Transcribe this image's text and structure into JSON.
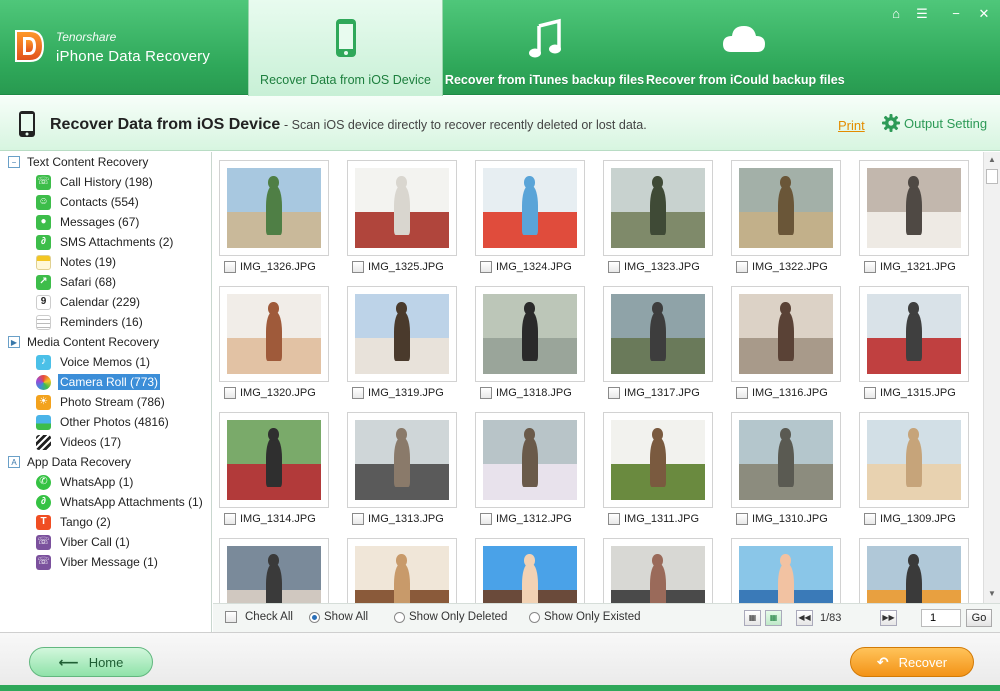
{
  "brand": {
    "company": "Tenorshare",
    "product": "iPhone Data Recovery"
  },
  "tabs": [
    {
      "label": "Recover Data from iOS Device",
      "icon": "phone-icon",
      "active": true
    },
    {
      "label": "Recover from iTunes backup files",
      "icon": "music-note-icon",
      "active": false
    },
    {
      "label": "Recover from iCould backup files",
      "icon": "cloud-icon",
      "active": false
    }
  ],
  "window_controls": [
    "home-icon",
    "menu-icon",
    "minimize-icon",
    "close-icon"
  ],
  "subheader": {
    "title": "Recover Data from iOS Device",
    "description": "- Scan iOS device directly to recover recently deleted or lost data.",
    "print_label": "Print",
    "output_setting_label": "Output Setting"
  },
  "tree": {
    "categories": [
      {
        "label": "Text Content Recovery",
        "items": [
          {
            "label": "Call History (198)",
            "icon": "phone-call-icon",
            "color": "#3dbd4a"
          },
          {
            "label": "Contacts (554)",
            "icon": "contacts-icon",
            "color": "#3dbd4a"
          },
          {
            "label": "Messages (67)",
            "icon": "message-bubble-icon",
            "color": "#3dbd4a"
          },
          {
            "label": "SMS Attachments (2)",
            "icon": "paperclip-icon",
            "color": "#3dbd4a"
          },
          {
            "label": "Notes (19)",
            "icon": "notes-icon",
            "color": "#f3c623"
          },
          {
            "label": "Safari (68)",
            "icon": "compass-icon",
            "color": "#3dbd4a"
          },
          {
            "label": "Calendar (229)",
            "icon": "calendar-icon",
            "color": "#ffffff"
          },
          {
            "label": "Reminders (16)",
            "icon": "list-icon",
            "color": "#ffffff"
          }
        ]
      },
      {
        "label": "Media Content Recovery",
        "items": [
          {
            "label": "Voice Memos (1)",
            "icon": "microphone-icon",
            "color": "#4bc0e8"
          },
          {
            "label": "Camera Roll (773)",
            "icon": "flower-icon",
            "color": "#e8e8e8",
            "selected": true
          },
          {
            "label": "Photo Stream (786)",
            "icon": "sun-icon",
            "color": "#f3a21d"
          },
          {
            "label": "Other Photos (4816)",
            "icon": "photos-icon",
            "color": "#4bb4e8"
          },
          {
            "label": "Videos (17)",
            "icon": "clapperboard-icon",
            "color": "#222222"
          }
        ]
      },
      {
        "label": "App Data Recovery",
        "items": [
          {
            "label": "WhatsApp (1)",
            "icon": "whatsapp-icon",
            "color": "#35c243"
          },
          {
            "label": "WhatsApp Attachments (1)",
            "icon": "paperclip-icon",
            "color": "#35c243"
          },
          {
            "label": "Tango (2)",
            "icon": "tango-icon",
            "color": "#f04e23"
          },
          {
            "label": "Viber Call (1)",
            "icon": "viber-icon",
            "color": "#7b519d"
          },
          {
            "label": "Viber Message (1)",
            "icon": "viber-icon",
            "color": "#7b519d"
          }
        ]
      }
    ]
  },
  "photos": [
    {
      "name": "IMG_1326.JPG",
      "colors": [
        "#a8c8e0",
        "#4f7f45",
        "#c9b99a"
      ]
    },
    {
      "name": "IMG_1325.JPG",
      "colors": [
        "#f3f3f0",
        "#d9d6cf",
        "#b0453c"
      ]
    },
    {
      "name": "IMG_1324.JPG",
      "colors": [
        "#e7eef2",
        "#5aa4d8",
        "#e04c3c"
      ]
    },
    {
      "name": "IMG_1323.JPG",
      "colors": [
        "#c8d2cf",
        "#3f4a36",
        "#7f8a6a"
      ]
    },
    {
      "name": "IMG_1322.JPG",
      "colors": [
        "#a3b0a8",
        "#6a5638",
        "#c2b08a"
      ]
    },
    {
      "name": "IMG_1321.JPG",
      "colors": [
        "#c2b7ad",
        "#4f4944",
        "#eeeae4"
      ]
    },
    {
      "name": "IMG_1320.JPG",
      "colors": [
        "#f1ede8",
        "#9f5a3a",
        "#e2c2a4"
      ]
    },
    {
      "name": "IMG_1319.JPG",
      "colors": [
        "#bdd3e8",
        "#4a3a2c",
        "#e8e2da"
      ]
    },
    {
      "name": "IMG_1318.JPG",
      "colors": [
        "#bcc6b8",
        "#2a2a2a",
        "#9aa59a"
      ]
    },
    {
      "name": "IMG_1317.JPG",
      "colors": [
        "#8fa3a8",
        "#3d3d3d",
        "#6a7a5a"
      ]
    },
    {
      "name": "IMG_1316.JPG",
      "colors": [
        "#dcd2c6",
        "#5a4236",
        "#a89a8a"
      ]
    },
    {
      "name": "IMG_1315.JPG",
      "colors": [
        "#d9e2e8",
        "#3f3f3f",
        "#c04040"
      ]
    },
    {
      "name": "IMG_1314.JPG",
      "colors": [
        "#7aaa6a",
        "#2f2f2f",
        "#b23a3a"
      ]
    },
    {
      "name": "IMG_1313.JPG",
      "colors": [
        "#cfd6d8",
        "#8a7a6a",
        "#5a5a5a"
      ]
    },
    {
      "name": "IMG_1312.JPG",
      "colors": [
        "#b8c4c8",
        "#6a5a4a",
        "#e8e2ec"
      ]
    },
    {
      "name": "IMG_1311.JPG",
      "colors": [
        "#f2f2ee",
        "#7a5a3f",
        "#6a8a3f"
      ]
    },
    {
      "name": "IMG_1310.JPG",
      "colors": [
        "#b4c6cc",
        "#5a5a52",
        "#8c8c7e"
      ]
    },
    {
      "name": "IMG_1309.JPG",
      "colors": [
        "#d2dfe6",
        "#c6a47a",
        "#e8d2b0"
      ]
    },
    {
      "name": "",
      "colors": [
        "#7a8a9a",
        "#3a3a3a",
        "#d0c8c0"
      ]
    },
    {
      "name": "",
      "colors": [
        "#f0e6d8",
        "#c89a6a",
        "#8a5a3a"
      ]
    },
    {
      "name": "",
      "colors": [
        "#4aa2e8",
        "#f2d2b4",
        "#6a4a3a"
      ]
    },
    {
      "name": "",
      "colors": [
        "#d8d8d4",
        "#9a6a5a",
        "#4a4a4a"
      ]
    },
    {
      "name": "",
      "colors": [
        "#8ac6e8",
        "#f2c2a2",
        "#3a7ab8"
      ]
    },
    {
      "name": "",
      "colors": [
        "#b0c8d8",
        "#3a3a3a",
        "#e8a040"
      ]
    }
  ],
  "bottombar": {
    "check_all_label": "Check All",
    "show_all_label": "Show All",
    "show_deleted_label": "Show Only Deleted",
    "show_existed_label": "Show Only Existed",
    "page_text": "1/83",
    "page_input": "1",
    "go_label": "Go"
  },
  "footer": {
    "home_label": "Home",
    "recover_label": "Recover"
  }
}
